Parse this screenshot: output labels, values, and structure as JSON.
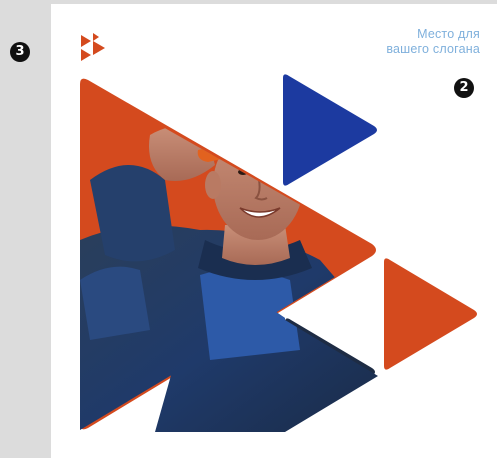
{
  "slogan": {
    "line1": "Место для",
    "line2": "вашего слогана"
  },
  "markers": {
    "left": "3",
    "right": "2"
  },
  "icons": {
    "logo": "logo-triangles-icon"
  },
  "colors": {
    "background": "#dcdcdc",
    "page": "#ffffff",
    "orange": "#d44a1e",
    "blue": "#1c3aa0",
    "slogan": "#7fb0dc",
    "marker": "#111111"
  }
}
